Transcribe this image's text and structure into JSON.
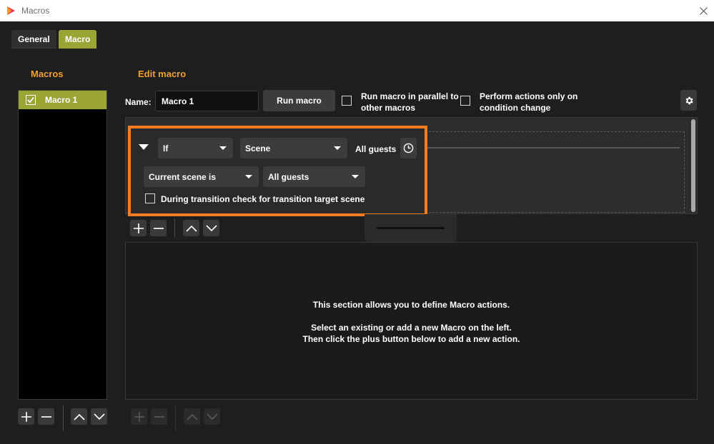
{
  "window": {
    "title": "Macros",
    "accent": "#9aa536",
    "highlight_color": "#f57c1f",
    "title_color": "#f0a030"
  },
  "tabs": [
    {
      "label": "General",
      "active": false
    },
    {
      "label": "Macro",
      "active": true
    }
  ],
  "macros_panel": {
    "title": "Macros",
    "items": [
      {
        "label": "Macro 1",
        "enabled": true,
        "selected": true
      }
    ],
    "toolbar": [
      "add-icon",
      "remove-icon",
      "move-up-icon",
      "move-down-icon"
    ]
  },
  "edit_macro": {
    "title": "Edit macro",
    "name_label": "Name:",
    "name_value": "Macro 1",
    "run_button": "Run macro",
    "parallel_label_line1": "Run macro in parallel to",
    "parallel_label_line2": "other macros",
    "parallel_checked": false,
    "change_label_line1": "Perform actions only on",
    "change_label_line2": "condition change",
    "change_checked": false,
    "settings_icon": "gear-icon"
  },
  "condition": {
    "logic": "If",
    "type": "Scene",
    "header_text": "All guests",
    "timer_icon": "clock-icon",
    "scene_check": "Current scene is",
    "scene_target": "All guests",
    "transition_label": "During transition check for transition target scene",
    "transition_checked": false,
    "toolbar": [
      "add-icon",
      "remove-icon",
      "move-up-icon",
      "move-down-icon"
    ]
  },
  "actions": {
    "info_line1": "This section allows you to define Macro actions.",
    "info_line2": "Select an existing or add a new Macro on the left.",
    "info_line3": "Then click the plus button below to add a new action.",
    "toolbar": [
      "add-icon",
      "remove-icon",
      "move-up-icon",
      "move-down-icon"
    ],
    "toolbar_enabled": false
  }
}
